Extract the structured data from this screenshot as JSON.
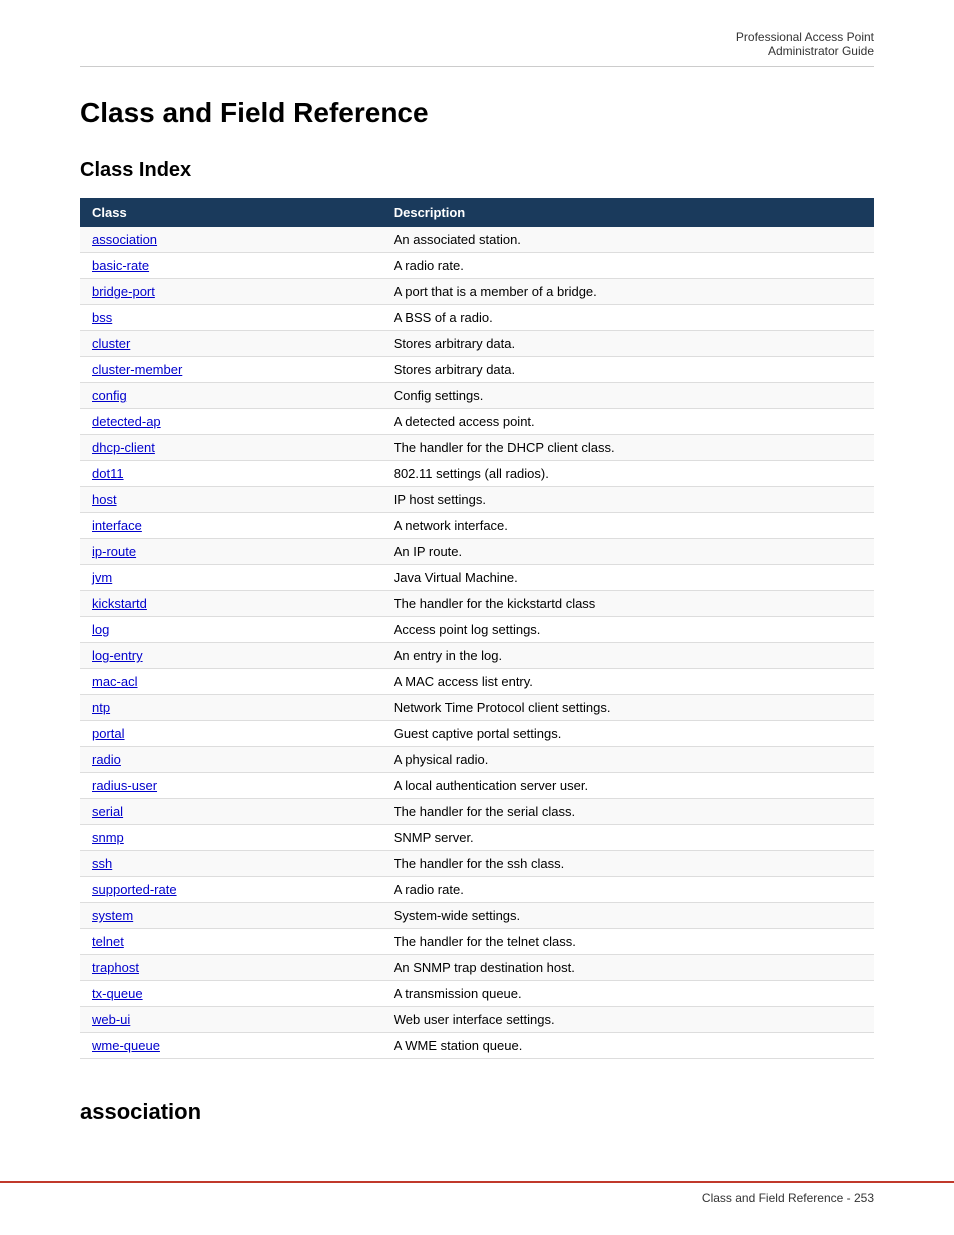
{
  "header": {
    "line1": "Professional Access Point",
    "line2": "Administrator Guide"
  },
  "page_title": "Class and Field Reference",
  "class_index_title": "Class Index",
  "table_headers": {
    "class": "Class",
    "description": "Description"
  },
  "table_rows": [
    {
      "class": "association",
      "description": "An associated station."
    },
    {
      "class": "basic-rate",
      "description": "A radio rate."
    },
    {
      "class": "bridge-port",
      "description": "A port that is a member of a bridge."
    },
    {
      "class": "bss",
      "description": "A BSS of a radio."
    },
    {
      "class": "cluster",
      "description": "Stores arbitrary data."
    },
    {
      "class": "cluster-member",
      "description": "Stores arbitrary data."
    },
    {
      "class": "config",
      "description": "Config settings."
    },
    {
      "class": "detected-ap",
      "description": "A detected access point."
    },
    {
      "class": "dhcp-client",
      "description": "The handler for the DHCP client class."
    },
    {
      "class": "dot11",
      "description": "802.11 settings (all radios)."
    },
    {
      "class": "host",
      "description": "IP host settings."
    },
    {
      "class": "interface",
      "description": "A network interface."
    },
    {
      "class": "ip-route",
      "description": "An IP route."
    },
    {
      "class": "jvm",
      "description": "Java Virtual Machine."
    },
    {
      "class": "kickstartd",
      "description": "The handler for the kickstartd class"
    },
    {
      "class": "log",
      "description": "Access point log settings."
    },
    {
      "class": "log-entry",
      "description": "An entry in the log."
    },
    {
      "class": "mac-acl",
      "description": "A MAC access list entry."
    },
    {
      "class": "ntp",
      "description": "Network Time Protocol client settings."
    },
    {
      "class": "portal",
      "description": "Guest captive portal settings."
    },
    {
      "class": "radio",
      "description": "A physical radio."
    },
    {
      "class": "radius-user",
      "description": "A local authentication server user."
    },
    {
      "class": "serial",
      "description": "The handler for the serial class."
    },
    {
      "class": "snmp",
      "description": "SNMP server."
    },
    {
      "class": "ssh",
      "description": "The handler for the ssh class."
    },
    {
      "class": "supported-rate",
      "description": "A radio rate."
    },
    {
      "class": "system",
      "description": "System-wide settings."
    },
    {
      "class": "telnet",
      "description": "The handler for the telnet class."
    },
    {
      "class": "traphost",
      "description": "An SNMP trap destination host."
    },
    {
      "class": "tx-queue",
      "description": "A transmission queue."
    },
    {
      "class": "web-ui",
      "description": "Web user interface settings."
    },
    {
      "class": "wme-queue",
      "description": "A WME station queue."
    }
  ],
  "association_section_title": "association",
  "footer": {
    "left": "",
    "right": "Class and Field Reference - 253"
  }
}
